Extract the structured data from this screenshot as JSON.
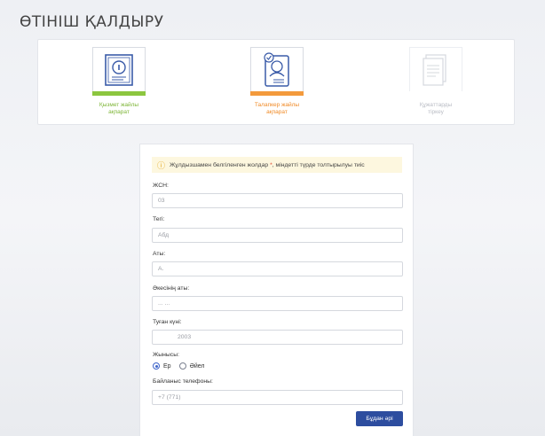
{
  "page": {
    "title": "ӨТІНІШ ҚАЛДЫРУ"
  },
  "steps": [
    {
      "label_line1": "Қызмет жайлы",
      "label_line2": "ақпарат",
      "icon": "info-document-icon",
      "color": "#8cc63f"
    },
    {
      "label_line1": "Талапкер жайлы",
      "label_line2": "ақпарат",
      "icon": "applicant-profile-icon",
      "color": "#f39a3c"
    },
    {
      "label_line1": "Құжаттарды",
      "label_line2": "тіркеу",
      "icon": "documents-icon",
      "color": "#b9bcc4"
    }
  ],
  "form": {
    "notice_before": "Жұлдызшамен белгіленген жолдар",
    "notice_star": "*",
    "notice_after": ", міндетті түрде толтырылуы тиіс",
    "fields": {
      "iin": {
        "label": "ЖСН:",
        "value": "03"
      },
      "surname": {
        "label": "Тегі:",
        "value": "Абд"
      },
      "name": {
        "label": "Аты:",
        "value": "А."
      },
      "patronymic": {
        "label": "Әкесінің аты:",
        "value": "... ..."
      },
      "birthdate": {
        "label": "Туған күні:",
        "value": "2003"
      },
      "phone": {
        "label": "Байланыс телефоны:",
        "value": "+7 (771)"
      }
    },
    "gender": {
      "label": "Жынысы:",
      "options": [
        "Ер",
        "Әйел"
      ],
      "selected": "Ер"
    },
    "next_label": "Бұдан әрі"
  },
  "colors": {
    "primary": "#2d4d9f",
    "step_done": "#8cc63f",
    "step_active": "#f39a3c",
    "notice_bg": "#fdf7df"
  }
}
